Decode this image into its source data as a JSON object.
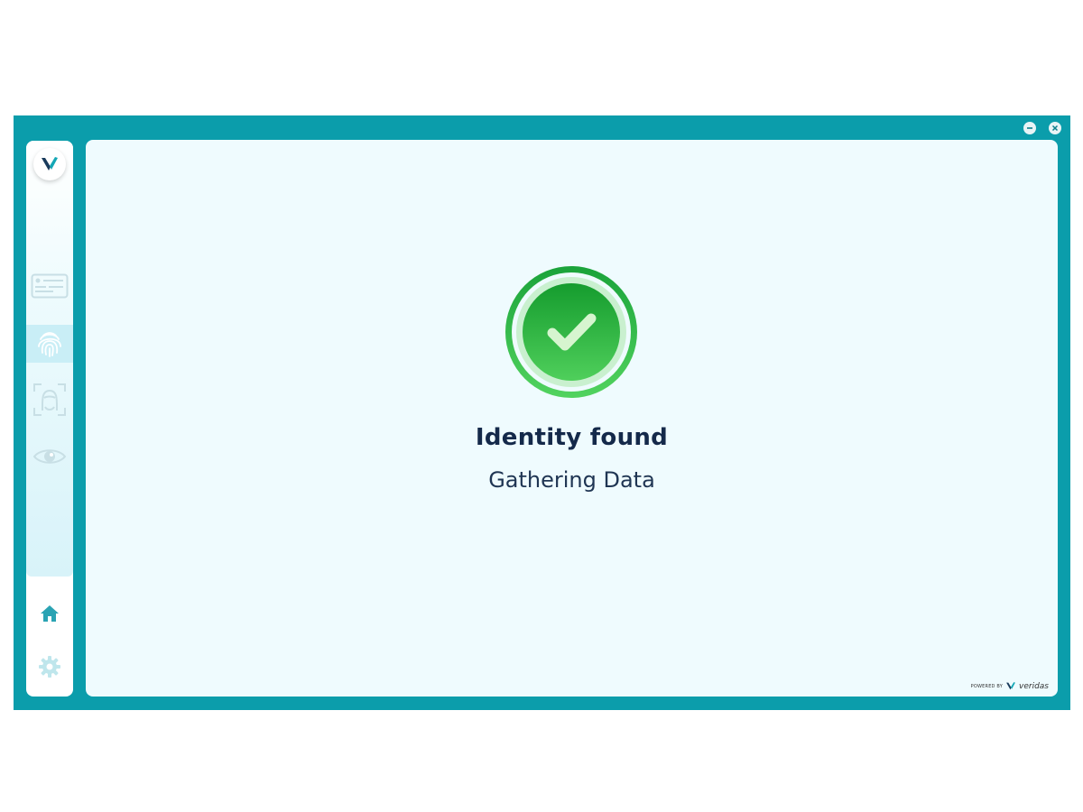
{
  "window": {
    "frame_color": "#0b9dab",
    "controls": [
      {
        "icon": "minimize-icon"
      },
      {
        "icon": "close-icon"
      }
    ]
  },
  "sidebar": {
    "logo_icon": "veridas-logo-icon",
    "items": [
      {
        "id": "id-document",
        "icon": "id-card-icon",
        "active": false
      },
      {
        "id": "fingerprint",
        "icon": "fingerprint-icon",
        "active": true
      },
      {
        "id": "face",
        "icon": "face-scan-icon",
        "active": false
      },
      {
        "id": "iris",
        "icon": "eye-icon",
        "active": false
      }
    ],
    "bottom": [
      {
        "id": "home",
        "icon": "home-icon"
      },
      {
        "id": "settings",
        "icon": "gear-icon"
      }
    ]
  },
  "main": {
    "status_icon": "check-circle-icon",
    "status_color": "#2bb24c",
    "title": "Identity found",
    "subtitle": "Gathering Data",
    "footer": {
      "powered_by": "POWERED BY",
      "brand": "veridas"
    }
  }
}
